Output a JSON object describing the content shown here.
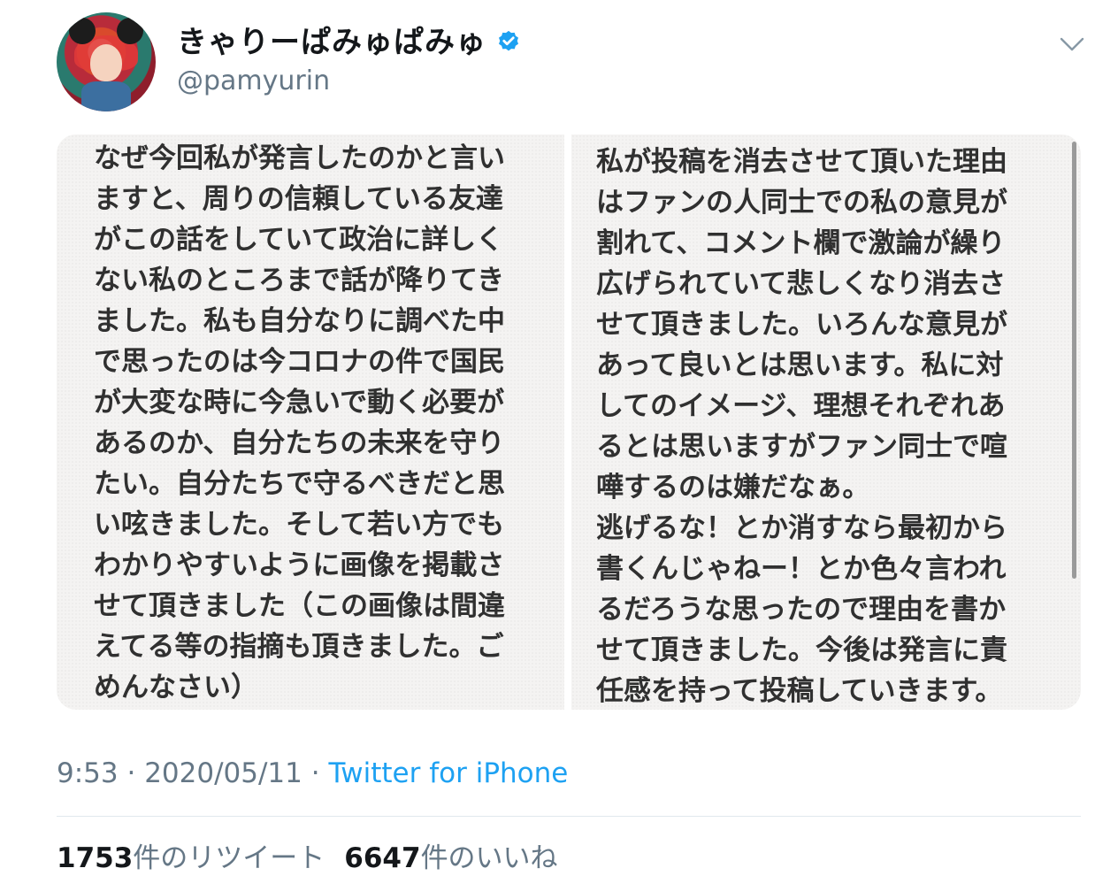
{
  "tweet": {
    "display_name": "きゃりーぱみゅぱみゅ",
    "handle": "@pamyurin",
    "verified": true,
    "accent_color": "#1da1f2",
    "left_image_text": "なぜ今回私が発言したのかと言い\nますと、周りの信頼している友達\nがこの話をしていて政治に詳しく\nない私のところまで話が降りてき\nました。私も自分なりに調べた中\nで思ったのは今コロナの件で国民\nが大変な時に今急いで動く必要が\nあるのか、自分たちの未来を守り\nたい。自分たちで守るべきだと思\nい呟きました。そして若い方でも\nわかりやすいように画像を掲載さ\nせて頂きました（この画像は間違\nえてる等の指摘も頂きました。ご\nめんなさい）",
    "right_image_text": "私が投稿を消去させて頂いた理由\nはファンの人同士での私の意見が\n割れて、コメント欄で激論が繰り\n広げられていて悲しくなり消去さ\nせて頂きました。いろんな意見が\nあって良いとは思います。私に対\nしてのイメージ、理想それぞれあ\nるとは思いますがファン同士で喧\n嘩するのは嫌だなぁ。\n逃げるな！とか消すなら最初から\n書くんじゃねー！とか色々言われ\nるだろうな思ったので理由を書か\nせて頂きました。今後は発言に責\n任感を持って投稿していきます。\n失礼致しました。",
    "time": "9:53",
    "separator": "·",
    "date": "2020/05/11",
    "source": "Twitter for iPhone",
    "retweet_count": "1753",
    "retweet_label": "件のリツイート",
    "like_count": "6647",
    "like_label": "件のいいね"
  }
}
